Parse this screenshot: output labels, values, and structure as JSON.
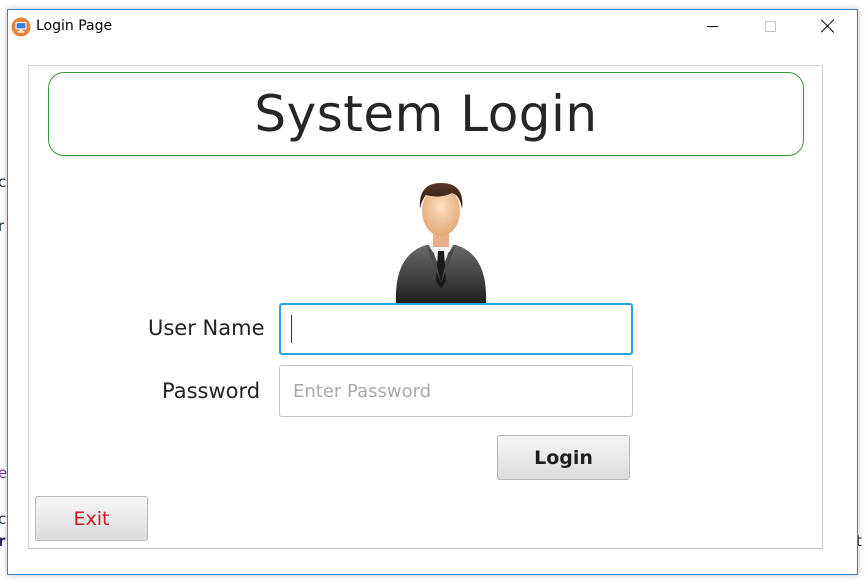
{
  "window": {
    "title": "Login Page",
    "icon": "computer-icon",
    "controls": [
      "minimize-icon",
      "maximize-icon",
      "close-icon"
    ]
  },
  "header": {
    "title": "System Login"
  },
  "avatar": {
    "icon": "user-businessman-icon"
  },
  "form": {
    "username_label": "User Name",
    "username_value": "",
    "password_label": "Password",
    "password_placeholder": "Enter Password"
  },
  "buttons": {
    "login": "Login",
    "exit": "Exit"
  },
  "colors": {
    "header_border": "#3a9a3a",
    "focus_border": "#2aa3dc",
    "exit_text": "#d21a1a"
  }
}
